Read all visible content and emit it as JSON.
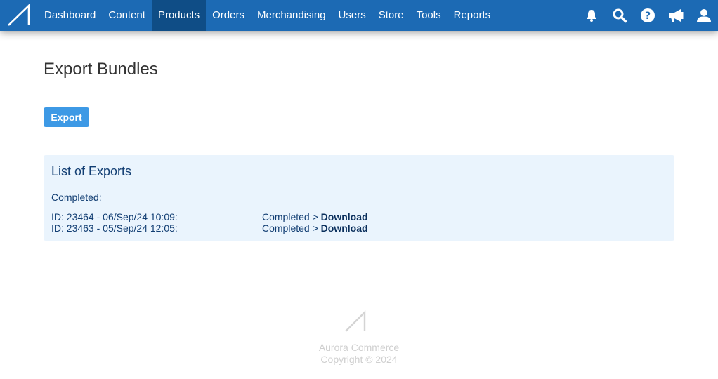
{
  "nav": {
    "items": [
      {
        "label": "Dashboard"
      },
      {
        "label": "Content"
      },
      {
        "label": "Products",
        "active": true
      },
      {
        "label": "Orders"
      },
      {
        "label": "Merchandising"
      },
      {
        "label": "Users"
      },
      {
        "label": "Store"
      },
      {
        "label": "Tools"
      },
      {
        "label": "Reports"
      }
    ],
    "icons": [
      "bell-icon",
      "search-icon",
      "help-icon",
      "megaphone-icon",
      "user-icon"
    ]
  },
  "page": {
    "title": "Export Bundles",
    "export_button": "Export"
  },
  "exports_panel": {
    "title": "List of Exports",
    "completed_label": "Completed:",
    "rows": [
      {
        "id_text": "ID: 23464 - 06/Sep/24 10:09:",
        "status": "Completed >",
        "link": "Download"
      },
      {
        "id_text": "ID: 23463 - 05/Sep/24 12:05:",
        "status": "Completed >",
        "link": "Download"
      }
    ]
  },
  "footer": {
    "brand": "Aurora Commerce",
    "copyright": "Copyright © 2024"
  },
  "colors": {
    "topbar": "#1c6ab4",
    "nav_active": "#0f4d86",
    "button": "#3d99e5",
    "panel_bg": "#eaf4fd",
    "panel_text": "#123e73"
  }
}
